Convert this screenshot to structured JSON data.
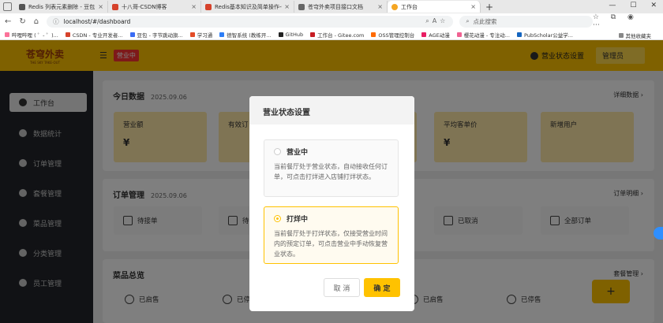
{
  "browser": {
    "tabs": [
      {
        "title": "Redis 列表元素删除 - 豆包",
        "color": "#555555",
        "active": false
      },
      {
        "title": "十八哥-CSDN博客",
        "color": "#d6422b",
        "active": false
      },
      {
        "title": "Redis基本知识及简单操作-CSDN",
        "color": "#d6422b",
        "active": false
      },
      {
        "title": "苍穹外卖项目接口文档",
        "color": "#666666",
        "active": false
      },
      {
        "title": "工作台",
        "color": "#f5a623",
        "active": true
      }
    ],
    "new_tab": "+",
    "url": "localhost/#/dashboard",
    "search_placeholder": "点此搜索",
    "bookmarks": [
      {
        "label": "哔哩哔哩 ( ゜- ゜)...",
        "color": "#fb7299"
      },
      {
        "label": "CSDN - 专业开发者...",
        "color": "#d6422b"
      },
      {
        "label": "豆包 - 字节跳动旗...",
        "color": "#3a6cf4"
      },
      {
        "label": "学习通",
        "color": "#e34c26"
      },
      {
        "label": "德智系统 (教练开...",
        "color": "#2d7ef7"
      },
      {
        "label": "GitHub",
        "color": "#222222"
      },
      {
        "label": "工作台 - Gitee.com",
        "color": "#c71d23"
      },
      {
        "label": "OSS管理控制台",
        "color": "#ff6a00"
      },
      {
        "label": "AGE动漫",
        "color": "#e91e63"
      },
      {
        "label": "樱花动漫 - 专注动...",
        "color": "#f06292"
      },
      {
        "label": "PubScholar公益学...",
        "color": "#1565c0"
      }
    ],
    "other_bookmarks": "其他收藏夹"
  },
  "header": {
    "logo_main": "苍穹外卖",
    "logo_sub": "THE SKY TAKE-OUT",
    "status_tag": "营业中",
    "store_setting": "营业状态设置",
    "admin": "管理员"
  },
  "sidebar": {
    "items": [
      {
        "label": "工作台",
        "active": true
      },
      {
        "label": "数据统计",
        "active": false
      },
      {
        "label": "订单管理",
        "active": false
      },
      {
        "label": "套餐管理",
        "active": false
      },
      {
        "label": "菜品管理",
        "active": false
      },
      {
        "label": "分类管理",
        "active": false
      },
      {
        "label": "员工管理",
        "active": false
      }
    ]
  },
  "today": {
    "title": "今日数据",
    "date": "2025.09.06",
    "more": "详细数据 ›",
    "stats": [
      {
        "label": "营业额",
        "value": "¥"
      },
      {
        "label": "有效订",
        "value": ""
      },
      {
        "label": "",
        "value": ""
      },
      {
        "label": "平均客单价",
        "value": "¥"
      },
      {
        "label": "新增用户",
        "value": ""
      }
    ]
  },
  "orders": {
    "title": "订单管理",
    "date": "2025.09.06",
    "more": "订单明细 ›",
    "items": [
      "待接单",
      "待",
      "已取消",
      "全部订单"
    ]
  },
  "dishes": {
    "title": "菜品总览",
    "more": "套餐管理 ›",
    "items": [
      "已启售",
      "已停售",
      "已启售",
      "已停售"
    ],
    "add": "+"
  },
  "modal": {
    "title": "营业状态设置",
    "options": [
      {
        "title": "营业中",
        "desc": "当前餐厅处于营业状态，自动接收任何订单，可点击打烊进入店铺打烊状态。",
        "selected": false
      },
      {
        "title": "打烊中",
        "desc": "当前餐厅处于打烊状态，仅接受营业时间内的预定订单，可点击营业中手动恢复营业状态。",
        "selected": true
      }
    ],
    "cancel": "取 消",
    "confirm": "确 定"
  }
}
